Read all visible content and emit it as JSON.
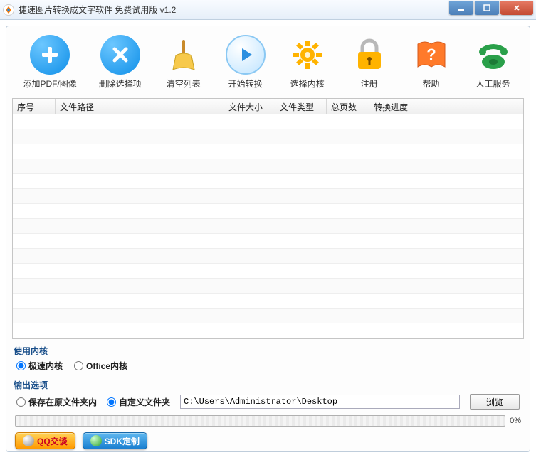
{
  "window": {
    "title": "捷速图片转换成文字软件 免费试用版 v1.2"
  },
  "toolbar": [
    {
      "id": "add-file",
      "label": "添加PDF/图像"
    },
    {
      "id": "delete-selected",
      "label": "删除选择项"
    },
    {
      "id": "clear-list",
      "label": "清空列表"
    },
    {
      "id": "start-convert",
      "label": "开始转换"
    },
    {
      "id": "select-engine",
      "label": "选择内核"
    },
    {
      "id": "register",
      "label": "注册"
    },
    {
      "id": "help",
      "label": "帮助"
    },
    {
      "id": "support",
      "label": "人工服务"
    }
  ],
  "table": {
    "columns": {
      "seq": "序号",
      "path": "文件路径",
      "size": "文件大小",
      "type": "文件类型",
      "pages": "总页数",
      "progress": "转换进度"
    },
    "rows": []
  },
  "engine": {
    "section_label": "使用内核",
    "fast_label": "极速内核",
    "office_label": "Office内核",
    "selected": "fast"
  },
  "output": {
    "section_label": "输出选项",
    "save_original_label": "保存在原文件夹内",
    "custom_folder_label": "自定义文件夹",
    "selected": "custom",
    "path": "C:\\Users\\Administrator\\Desktop",
    "browse_label": "浏览"
  },
  "progress": {
    "percent_text": "0%"
  },
  "footer": {
    "qq_label": "QQ交谈",
    "sdk_label": "SDK定制"
  }
}
